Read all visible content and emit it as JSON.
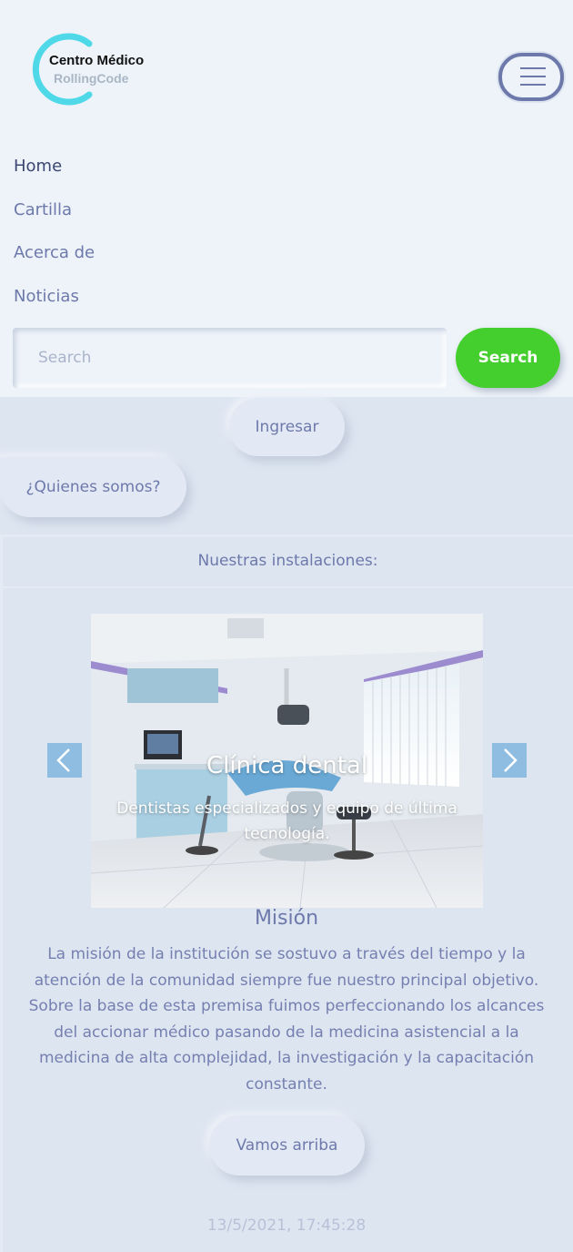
{
  "brand": {
    "title": "Centro Médico",
    "subtitle": "RollingCode"
  },
  "nav": {
    "toggle_icon": "hamburger-icon",
    "links": [
      {
        "label": "Home",
        "active": true
      },
      {
        "label": "Cartilla",
        "active": false
      },
      {
        "label": "Acerca de",
        "active": false
      },
      {
        "label": "Noticias",
        "active": false
      }
    ]
  },
  "search": {
    "placeholder": "Search",
    "value": "",
    "button_label": "Search",
    "button_color": "#44cf2e"
  },
  "actions": {
    "login_label": "Ingresar",
    "about_label": "¿Quienes somos?"
  },
  "installations": {
    "header": "Nuestras instalaciones:",
    "slide": {
      "title": "Clínica dental",
      "description": "Dentistas especializados y equipo de última tecnología."
    },
    "prev_icon": "chevron-left-icon",
    "next_icon": "chevron-right-icon"
  },
  "mission": {
    "title": "Misión",
    "text": "La misión de la institución se sostuvo a través del tiempo y la atención de la comunidad siempre fue nuestro principal objetivo. Sobre la base de esta premisa fuimos perfeccionando los alcances del accionar médico pasando de la medicina asistencial a la medicina de alta complejidad, la investigación y la capacitación constante."
  },
  "back_to_top_label": "Vamos arriba",
  "clock": "13/5/2021, 17:45:28",
  "colors": {
    "page_bg": "#dde5f1",
    "navbar_bg": "#eef3f9",
    "text": "#6d79ab",
    "logo_ring": "#4fd9e8",
    "carousel_control": "#8fbde2"
  }
}
